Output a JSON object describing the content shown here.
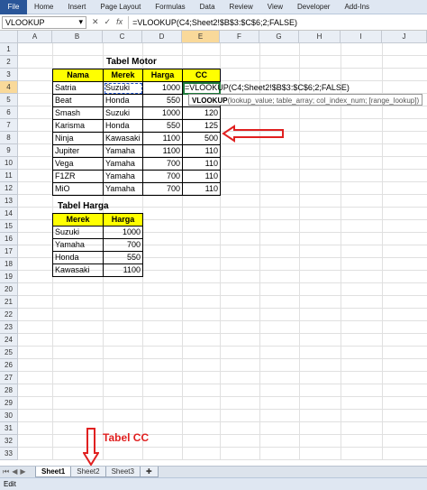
{
  "ribbon": {
    "file": "File",
    "tabs": [
      "Home",
      "Insert",
      "Page Layout",
      "Formulas",
      "Data",
      "Review",
      "View",
      "Developer",
      "Add-Ins"
    ]
  },
  "formula_bar": {
    "name_box": "VLOOKUP",
    "formula": "=VLOOKUP(C4;Sheet2!$B$3:$C$6;2;FALSE)",
    "icons": [
      "dropdown-icon",
      "cancel-icon",
      "enter-icon",
      "fx-icon"
    ]
  },
  "columns": [
    "A",
    "B",
    "C",
    "D",
    "E",
    "F",
    "G",
    "H",
    "I",
    "J"
  ],
  "rows": [
    "1",
    "2",
    "3",
    "4",
    "5",
    "6",
    "7",
    "8",
    "9",
    "10",
    "11",
    "12",
    "13",
    "14",
    "15",
    "16",
    "17",
    "18",
    "19",
    "20",
    "21",
    "22",
    "23",
    "24",
    "25",
    "26",
    "27",
    "28",
    "29",
    "30",
    "31",
    "32",
    "33"
  ],
  "motor_table": {
    "title": "Tabel Motor",
    "headers": [
      "Nama",
      "Merek",
      "Harga",
      "CC"
    ],
    "rows": [
      [
        "Satria",
        "Suzuki",
        "1000",
        "=VLOOKUP(C4;Sheet2!$B$3:$C$6;2;FALSE)"
      ],
      [
        "Beat",
        "Honda",
        "550",
        ""
      ],
      [
        "Smash",
        "Suzuki",
        "1000",
        "120"
      ],
      [
        "Karisma",
        "Honda",
        "550",
        "125"
      ],
      [
        "Ninja",
        "Kawasaki",
        "1100",
        "500"
      ],
      [
        "Jupiter",
        "Yamaha",
        "1100",
        "110"
      ],
      [
        "Vega",
        "Yamaha",
        "700",
        "110"
      ],
      [
        "F1ZR",
        "Yamaha",
        "700",
        "110"
      ],
      [
        "MiO",
        "Yamaha",
        "700",
        "110"
      ]
    ]
  },
  "tooltip": {
    "fn": "VLOOKUP",
    "args": "(lookup_value; table_array; col_index_num; [range_lookup])"
  },
  "price_table": {
    "title": "Tabel Harga",
    "headers": [
      "Merek",
      "Harga"
    ],
    "rows": [
      [
        "Suzuki",
        "1000"
      ],
      [
        "Yamaha",
        "700"
      ],
      [
        "Honda",
        "550"
      ],
      [
        "Kawasaki",
        "1100"
      ]
    ]
  },
  "annotation": {
    "label": "Tabel CC",
    "color": "#e02020"
  },
  "sheets": [
    "Sheet1",
    "Sheet2",
    "Sheet3"
  ],
  "status": "Edit",
  "colors": {
    "header_fill": "#ffff00",
    "accent": "#2a5699"
  }
}
